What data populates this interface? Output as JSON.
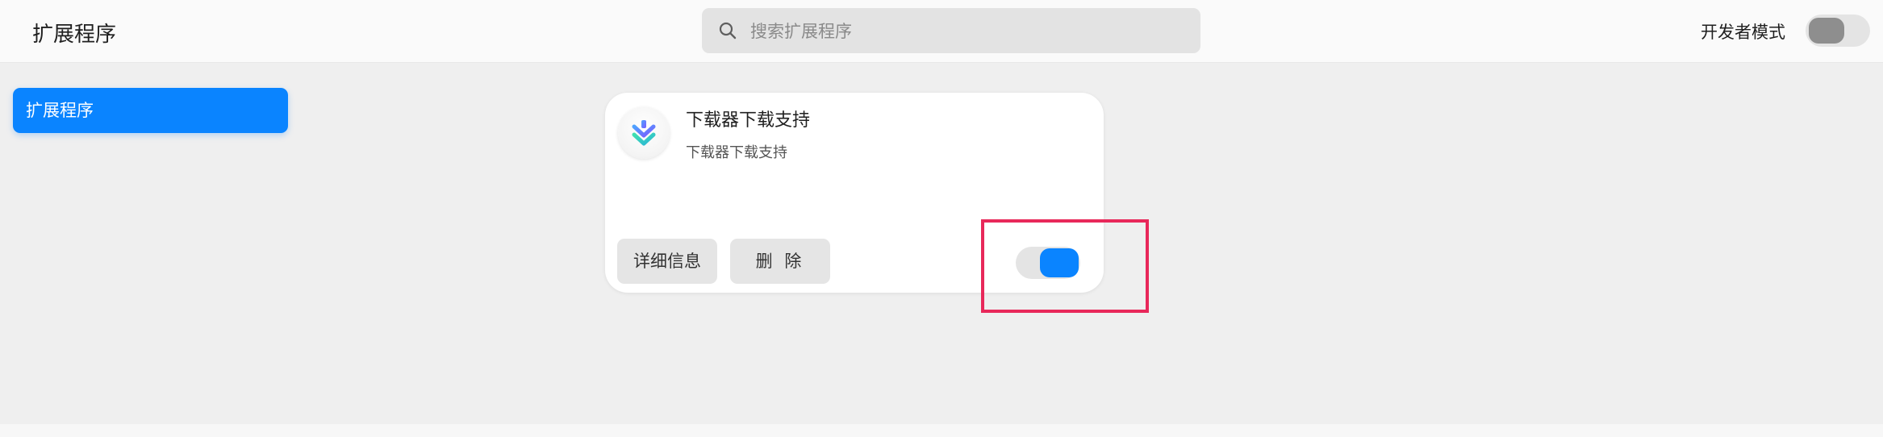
{
  "header": {
    "title": "扩展程序",
    "search_placeholder": "搜索扩展程序",
    "search_value": "",
    "developer_mode_label": "开发者模式",
    "developer_mode_on": false
  },
  "sidebar": {
    "items": [
      {
        "label": "扩展程序",
        "selected": true
      }
    ]
  },
  "extensions": [
    {
      "name": "下载器下载支持",
      "description": "下载器下载支持",
      "details_label": "详细信息",
      "remove_label": "删 除",
      "enabled": true,
      "icon": "download-chevrons-icon"
    }
  ],
  "colors": {
    "accent": "#0a84ff",
    "highlight": "#e8285a",
    "background": "#efefef"
  }
}
